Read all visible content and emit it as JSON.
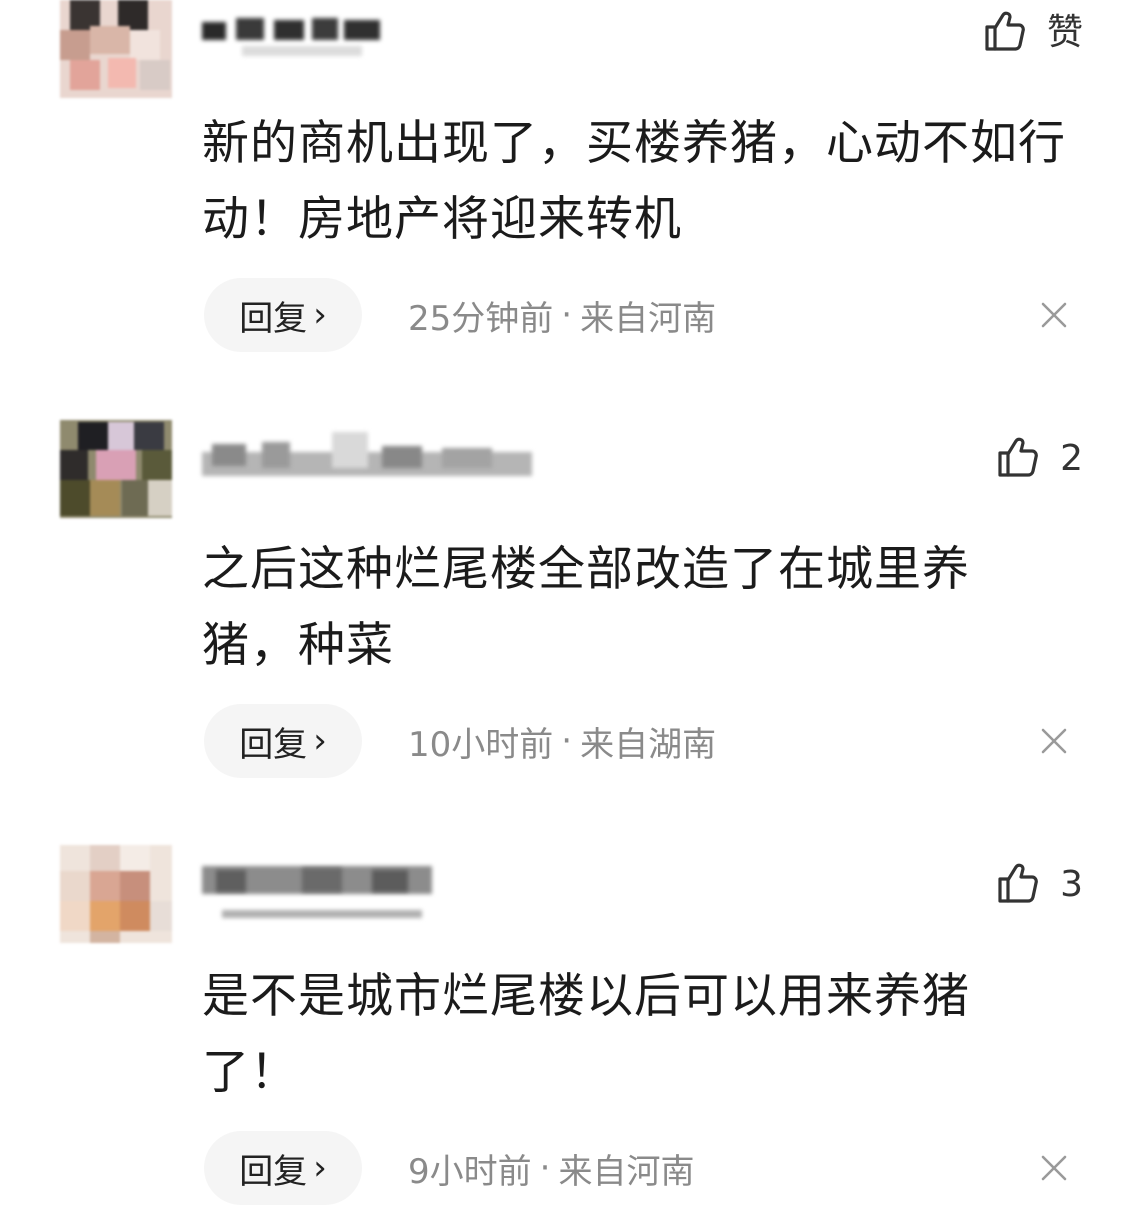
{
  "colors": {
    "text_primary": "#1b1b1b",
    "text_secondary": "#8a8a8a",
    "reply_bg": "#f5f5f5",
    "icon": "#333333"
  },
  "icons": {
    "like": "thumbs-up-icon",
    "close": "close-icon",
    "reply_chevron": "chevron-right-icon"
  },
  "comments": [
    {
      "like_label": "赞",
      "text": "新的商机出现了，买楼养猪，心动不如行动！房地产将迎来转机",
      "reply_label": "回复",
      "reply_chevron": "›",
      "time": "25分钟前",
      "separator": "·",
      "location": "来自河南"
    },
    {
      "like_label": "2",
      "text": "之后这种烂尾楼全部改造了在城里养猪，种菜",
      "reply_label": "回复",
      "reply_chevron": "›",
      "time": "10小时前",
      "separator": "·",
      "location": "来自湖南"
    },
    {
      "like_label": "3",
      "text": "是不是城市烂尾楼以后可以用来养猪了！",
      "reply_label": "回复",
      "reply_chevron": "›",
      "time": "9小时前",
      "separator": "·",
      "location": "来自河南"
    }
  ]
}
